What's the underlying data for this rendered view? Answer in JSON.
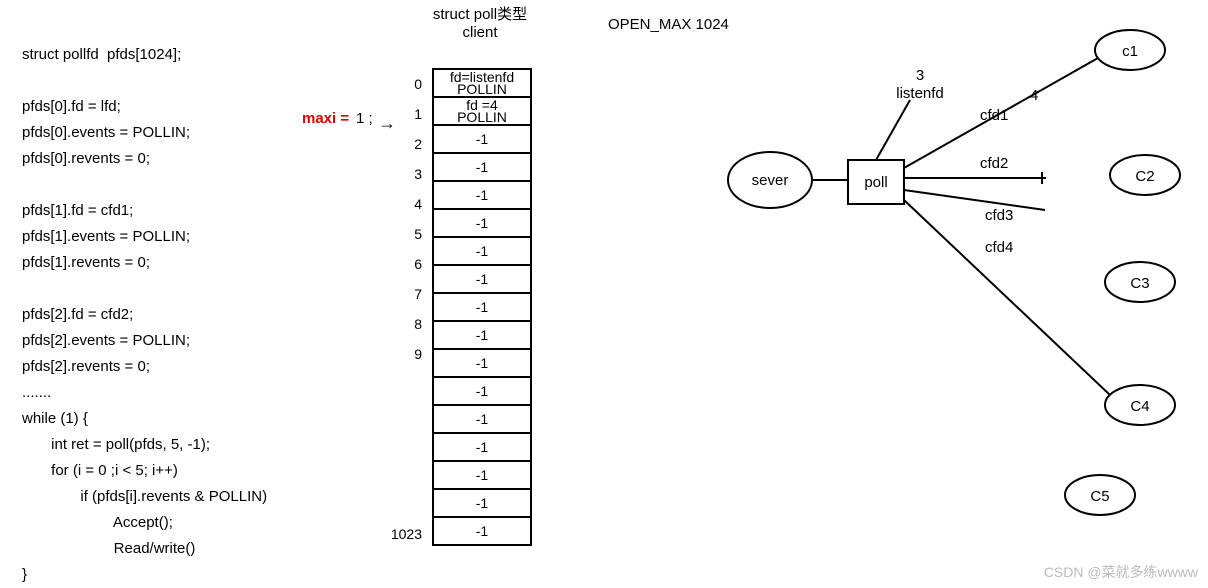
{
  "code": {
    "decl": "struct pollfd  pfds[1024];",
    "b1l1": "pfds[0].fd = lfd;",
    "b1l2": "pfds[0].events = POLLIN;",
    "b1l3": "pfds[0].revents = 0;",
    "b2l1": "pfds[1].fd = cfd1;",
    "b2l2": "pfds[1].events = POLLIN;",
    "b2l3": "pfds[1].revents = 0;",
    "b3l1": "pfds[2].fd = cfd2;",
    "b3l2": "pfds[2].events = POLLIN;",
    "b3l3": "pfds[2].revents = 0;",
    "dots": ".......",
    "w1": "while (1) {",
    "w2": "       int ret = poll(pfds, 5, -1);",
    "w3": "       for (i = 0 ;i < 5; i++)",
    "w4": "              if (pfds[i].revents & POLLIN)",
    "w5": "                      Accept();",
    "w6": "                      Read/write()",
    "w7": "}"
  },
  "maxi_label": "maxi =",
  "maxi_value": "1 ;",
  "arrow": "→",
  "table_header_l1": "struct poll类型",
  "table_header_l2": "client",
  "open_max": "OPEN_MAX 1024",
  "cells": {
    "c0a": "fd=listenfd",
    "c0b": "POLLIN",
    "c1a": "fd =4",
    "c1b": "POLLIN",
    "neg1": "-1"
  },
  "idx": {
    "i0": "0",
    "i1": "1",
    "i2": "2",
    "i3": "3",
    "i4": "4",
    "i5": "5",
    "i6": "6",
    "i7": "7",
    "i8": "8",
    "i9": "9",
    "ilast": "1023"
  },
  "graph": {
    "sever": "sever",
    "poll": "poll",
    "listenfd_num": "3",
    "listenfd": "listenfd",
    "four": "4",
    "cfd1": "cfd1",
    "cfd2": "cfd2",
    "cfd3": "cfd3",
    "cfd4": "cfd4",
    "c1": "c1",
    "c2": "C2",
    "c3": "C3",
    "c4": "C4",
    "c5": "C5"
  },
  "watermark": "CSDN @菜就多练wwww"
}
